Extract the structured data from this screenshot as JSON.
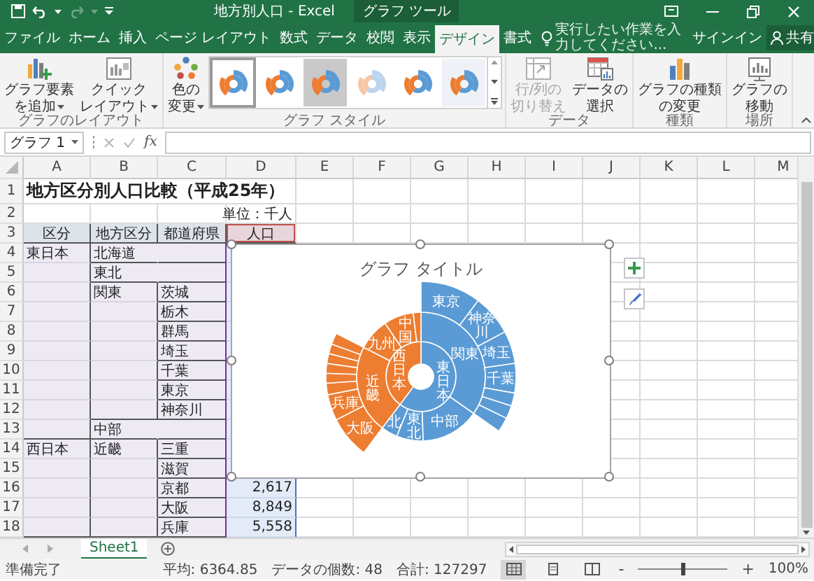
{
  "title_bar": {
    "title": "地方別人口 - Excel",
    "context_title": "グラフ ツール"
  },
  "tabs": [
    {
      "label": "ファイル",
      "selected": false
    },
    {
      "label": "ホーム",
      "selected": false
    },
    {
      "label": "挿入",
      "selected": false
    },
    {
      "label": "ページ レイアウト",
      "selected": false
    },
    {
      "label": "数式",
      "selected": false
    },
    {
      "label": "データ",
      "selected": false
    },
    {
      "label": "校閲",
      "selected": false
    },
    {
      "label": "表示",
      "selected": false
    },
    {
      "label": "デザイン",
      "selected": true
    },
    {
      "label": "書式",
      "selected": false
    }
  ],
  "tell_me": {
    "placeholder": "実行したい作業を入力してください..."
  },
  "account": {
    "sign_in": "サインイン",
    "share": "共有"
  },
  "ribbon": {
    "groups": [
      {
        "label": "グラフのレイアウト",
        "buttons": [
          {
            "kind": "add-element",
            "label": [
              "グラフ要素",
              "を追加"
            ],
            "dropdown": true,
            "disabled": false
          },
          {
            "kind": "quick-layout",
            "label": [
              "クイック",
              "レイアウト"
            ],
            "dropdown": true,
            "disabled": false
          }
        ]
      },
      {
        "label": "グラフ スタイル",
        "buttons": [
          {
            "kind": "colors",
            "label": [
              "色の",
              "変更"
            ],
            "dropdown": true,
            "disabled": false
          }
        ],
        "styles": [
          {
            "kind": "white",
            "selected": true
          },
          {
            "kind": "white",
            "selected": false
          },
          {
            "kind": "gray",
            "selected": false
          },
          {
            "kind": "pale",
            "selected": false
          },
          {
            "kind": "white",
            "selected": false
          },
          {
            "kind": "hatched",
            "selected": false
          }
        ]
      },
      {
        "label": "データ",
        "buttons": [
          {
            "kind": "switch",
            "label": [
              "行/列の",
              "切り替え"
            ],
            "dropdown": false,
            "disabled": true
          },
          {
            "kind": "select-data",
            "label": [
              "データの",
              "選択"
            ],
            "dropdown": false,
            "disabled": false
          }
        ]
      },
      {
        "label": "種類",
        "buttons": [
          {
            "kind": "chart-type",
            "label": [
              "グラフの種類",
              "の変更"
            ],
            "dropdown": false,
            "disabled": false
          }
        ]
      },
      {
        "label": "場所",
        "buttons": [
          {
            "kind": "move",
            "label": [
              "グラフの",
              "移動"
            ],
            "dropdown": false,
            "disabled": false
          }
        ]
      }
    ]
  },
  "formula_bar": {
    "name_box": "グラフ 1",
    "function_label": "fx"
  },
  "sheet": {
    "columns": [
      "A",
      "B",
      "C",
      "D",
      "E",
      "F",
      "G",
      "H",
      "I",
      "J",
      "K",
      "L",
      "M"
    ],
    "rows": [
      {
        "number": "1",
        "kind": "title",
        "a": "地方区分別人口比較（平成25年）"
      },
      {
        "number": "2",
        "kind": "unit",
        "d": "単位：千人"
      },
      {
        "number": "3",
        "kind": "header",
        "a": "区分",
        "b": "地方区分",
        "c": "都道府県",
        "d": "人口"
      },
      {
        "number": "4",
        "kind": "data",
        "a": "東日本",
        "b": "北海道"
      },
      {
        "number": "5",
        "kind": "data",
        "b": "東北"
      },
      {
        "number": "6",
        "kind": "data",
        "b": "関東",
        "c": "茨城"
      },
      {
        "number": "7",
        "kind": "data",
        "c": "栃木"
      },
      {
        "number": "8",
        "kind": "data",
        "c": "群馬"
      },
      {
        "number": "9",
        "kind": "data",
        "c": "埼玉"
      },
      {
        "number": "10",
        "kind": "data",
        "c": "千葉"
      },
      {
        "number": "11",
        "kind": "data",
        "c": "東京"
      },
      {
        "number": "12",
        "kind": "data",
        "c": "神奈川"
      },
      {
        "number": "13",
        "kind": "data",
        "b": "中部"
      },
      {
        "number": "14",
        "kind": "data",
        "a": "西日本",
        "b": "近畿",
        "c": "三重"
      },
      {
        "number": "15",
        "kind": "data",
        "c": "滋賀"
      },
      {
        "number": "16",
        "kind": "data",
        "c": "京都",
        "d": "2,617"
      },
      {
        "number": "17",
        "kind": "data",
        "c": "大阪",
        "d": "8,849"
      },
      {
        "number": "18",
        "kind": "data",
        "c": "兵庫",
        "d": "5,558"
      }
    ]
  },
  "chart": {
    "title": "グラフ タイトル",
    "groups": [
      {
        "label": "東日本",
        "color": "#5b9bd5",
        "regions": [
          "関東",
          "北",
          "東北",
          "中部"
        ],
        "prefectures": [
          "東京",
          "神奈川",
          "埼玉",
          "千葉"
        ]
      },
      {
        "label": "西日本",
        "color": "#ed7d31",
        "regions": [
          "近畿",
          "九州",
          "中国"
        ],
        "prefectures": [
          "大阪",
          "兵庫"
        ]
      }
    ]
  },
  "sheet_tabs": [
    {
      "label": "Sheet1",
      "selected": true
    }
  ],
  "status_bar": {
    "status": "準備完了",
    "stats": [
      "平均: 6364.85",
      "データの個数: 48",
      "合計: 127297"
    ],
    "views": [
      {
        "kind": "normal",
        "selected": true
      },
      {
        "kind": "page-layout",
        "selected": false
      },
      {
        "kind": "page-break",
        "selected": false
      }
    ],
    "zoom_out": "-",
    "zoom_in": "+",
    "zoom": {
      "level": 0.5,
      "reading": "100%"
    }
  }
}
